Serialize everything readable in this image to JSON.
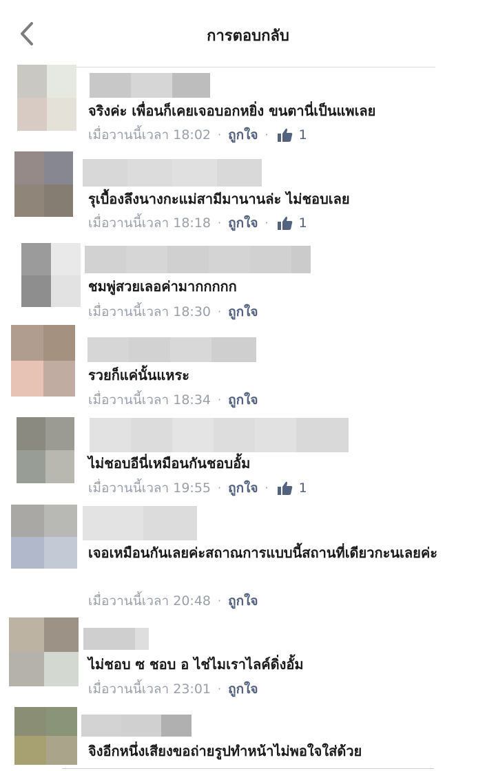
{
  "header": {
    "title": "การตอบกลับ",
    "back_icon": "chevron-left-icon"
  },
  "meta": {
    "like_label": "ถูกใจ",
    "separator": "·",
    "thumb_icon": "thumbs-up-icon",
    "like_color": "#53627f",
    "time_color": "#9aa0aa"
  },
  "comments": [
    {
      "text": "จริงค่ะ เพื่อนก็เคยเจอบอกหยิ่ง ขนตานี่เป็นแพเลย",
      "time": "เมื่อวานนี้เวลา 18:02",
      "likes": "1"
    },
    {
      "text": "รุเบื้องลึงนางกะแม่สามีมานานล่ะ ไม่ชอบเลย",
      "time": "เมื่อวานนี้เวลา 18:18",
      "likes": "1"
    },
    {
      "text": "ชมพู่สวยเลอค่ามากกกกก",
      "time": "เมื่อวานนี้เวลา 18:30"
    },
    {
      "text": "รวยก็แค่นั้นแหระ",
      "time": "เมื่อวานนี้เวลา 18:34"
    },
    {
      "text": "ไม่ชอบอีนี่เหมือนกันชอบอั้ม",
      "time": "เมื่อวานนี้เวลา 19:55",
      "likes": "1"
    },
    {
      "text": "เจอเหมือนกันเลยค่ะสถาณการแบบนี้สถานที่เดียวกะนเลยค่ะ",
      "time": "เมื่อวานนี้เวลา 20:48"
    },
    {
      "text": "ไม่ชอบ ซ ชอบ อ ไช่ไมเราไลค์ดิ่งอั้ม",
      "time": "เมื่อวานนี้เวลา 23:01"
    },
    {
      "text": "จิงอีกหนึ่งเสียงขอถ่ายรูปทำหน้าไม่พอใจใส่ด้วย"
    }
  ]
}
